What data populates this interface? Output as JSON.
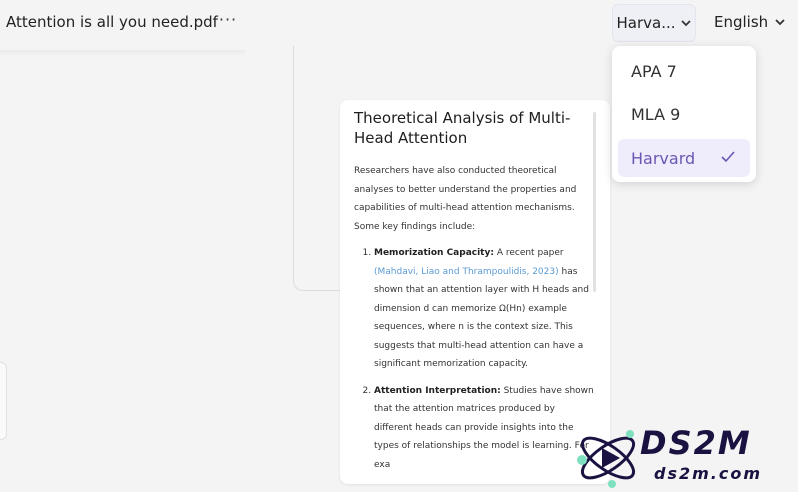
{
  "header": {
    "doc_title": "Attention is all you need.pdf",
    "more_label": "···",
    "citation_style_selected": "Harva...",
    "language_selected": "English"
  },
  "dropdown": {
    "items": [
      {
        "label": "APA 7",
        "selected": false
      },
      {
        "label": "MLA 9",
        "selected": false
      },
      {
        "label": "Harvard",
        "selected": true
      }
    ]
  },
  "card": {
    "heading": "Theoretical Analysis of Multi-Head Attention",
    "intro": "Researchers have also conducted theoretical analyses to better understand the properties and capabilities of multi-head attention mechanisms. Some key findings include:",
    "findings": [
      {
        "title": "Memorization Capacity:",
        "pre": " A recent paper ",
        "citation": "(Mahdavi, Liao and Thrampoulidis, 2023)",
        "post": " has shown that an attention layer with H heads and dimension d can memorize Ω(Hn) example sequences, where n is the context size. This suggests that multi-head attention can have a significant memorization capacity."
      },
      {
        "title": "Attention Interpretation:",
        "pre": " Studies have shown that the attention matrices produced by different heads can provide insights into the types of relationships the model is learning. For exa",
        "citation": "",
        "post": ""
      }
    ]
  },
  "watermark": {
    "line1": "DS2M",
    "line2": "ds2m.com"
  },
  "colors": {
    "accent_purple": "#6b57b3",
    "selected_bg": "#efecfb",
    "link_blue": "#5b9bd5"
  }
}
